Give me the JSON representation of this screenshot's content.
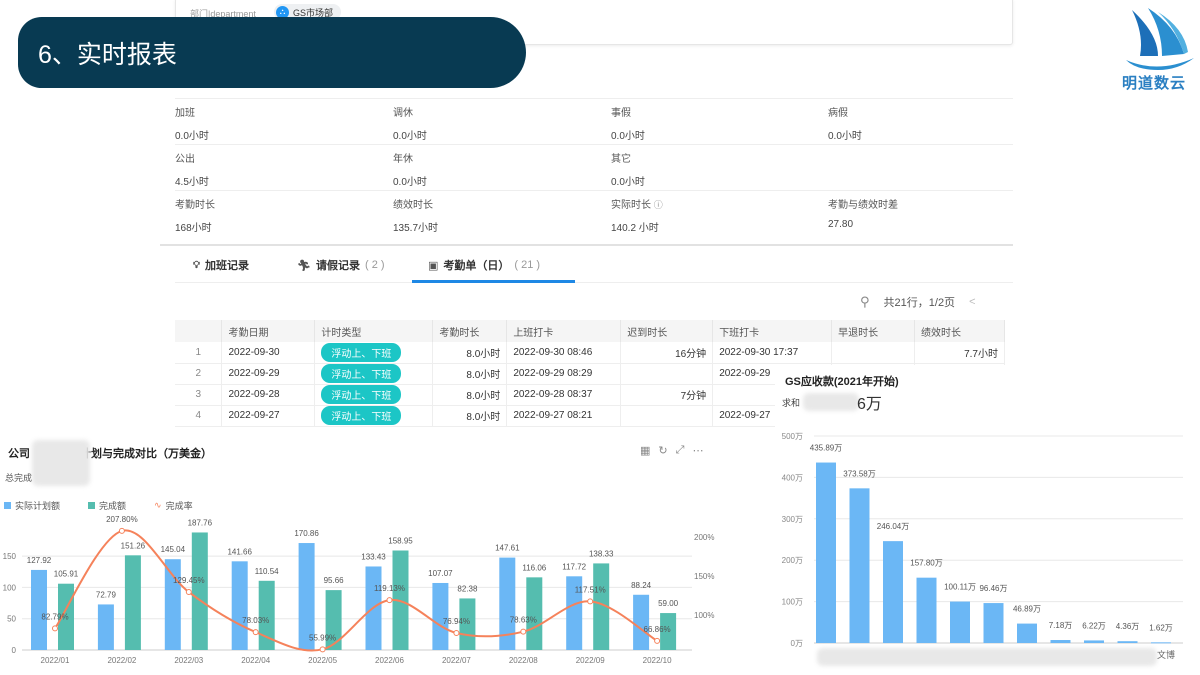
{
  "slide_title": "6、实时报表",
  "logo_text": "明道数云",
  "department": {
    "label": "部门|department",
    "value": "GS市场部"
  },
  "stats": [
    [
      {
        "label": "加班",
        "value": "0.0小时"
      },
      {
        "label": "调休",
        "value": "0.0小时"
      },
      {
        "label": "事假",
        "value": "0.0小时"
      },
      {
        "label": "病假",
        "value": "0.0小时"
      }
    ],
    [
      {
        "label": "公出",
        "value": "4.5小时"
      },
      {
        "label": "年休",
        "value": "0.0小时"
      },
      {
        "label": "其它",
        "value": "0.0小时"
      }
    ],
    [
      {
        "label": "考勤时长",
        "value": "168小时"
      },
      {
        "label": "绩效时长",
        "value": "135.7小时"
      },
      {
        "label": "实际时长",
        "value": "140.2 小时"
      },
      {
        "label": "考勤与绩效时差",
        "value": "27.80"
      }
    ]
  ],
  "tabs": [
    {
      "label": "加班记录",
      "count": ""
    },
    {
      "label": "请假记录",
      "count": "( 2 )"
    },
    {
      "label": "考勤单（日）",
      "count": "( 21 )"
    }
  ],
  "pagination": {
    "text": "共21行，1/2页",
    "prev": "<"
  },
  "table": {
    "headers": [
      "",
      "考勤日期",
      "计时类型",
      "考勤时长",
      "上班打卡",
      "迟到时长",
      "下班打卡",
      "早退时长",
      "绩效时长"
    ],
    "rows": [
      [
        "1",
        "2022-09-30",
        "浮动上、下班",
        "8.0小时",
        "2022-09-30 08:46",
        "16分钟",
        "2022-09-30 17:37",
        "",
        "7.7小时"
      ],
      [
        "2",
        "2022-09-29",
        "浮动上、下班",
        "8.0小时",
        "2022-09-29 08:29",
        "",
        "2022-09-29",
        "",
        ""
      ],
      [
        "3",
        "2022-09-28",
        "浮动上、下班",
        "8.0小时",
        "2022-09-28 08:37",
        "7分钟",
        "",
        "",
        ""
      ],
      [
        "4",
        "2022-09-27",
        "浮动上、下班",
        "8.0小时",
        "2022-09-27 08:21",
        "",
        "2022-09-27",
        "",
        ""
      ]
    ]
  },
  "left_panel": {
    "title_prefix": "公司",
    "title_suffix": "计划与完成对比（万美金）",
    "subtitle_prefix": "总完成"
  },
  "right_panel": {
    "title": "GS应收款(2021年开始)",
    "sum_prefix": "求和",
    "sum_suffix": "6万",
    "last_x_label": "文博"
  },
  "colors": {
    "plan": "#6bb7f5",
    "done": "#55bdaf",
    "rate": "#f5825b",
    "title_bg": "#083a52",
    "tag": "#1cc6c6"
  },
  "chart_data": [
    {
      "type": "bar+line",
      "title": "公司…计划与完成对比（万美金）",
      "categories": [
        "2022/01",
        "2022/02",
        "2022/03",
        "2022/04",
        "2022/05",
        "2022/06",
        "2022/07",
        "2022/08",
        "2022/09",
        "2022/10"
      ],
      "series": [
        {
          "name": "实际计划额",
          "type": "bar",
          "values": [
            127.92,
            72.79,
            145.04,
            141.66,
            170.86,
            133.43,
            107.07,
            147.61,
            117.72,
            88.24
          ]
        },
        {
          "name": "完成额",
          "type": "bar",
          "values": [
            105.91,
            151.26,
            187.76,
            110.54,
            95.66,
            158.95,
            82.38,
            116.06,
            138.33,
            59.0
          ]
        },
        {
          "name": "完成率",
          "type": "line",
          "axis": "right",
          "values": [
            82.79,
            207.8,
            129.45,
            78.03,
            55.99,
            119.13,
            76.94,
            78.63,
            117.51,
            66.86
          ]
        }
      ],
      "labels": {
        "bar1": [
          "127.92",
          "72.79",
          "145.04",
          "141.66",
          "170.86",
          "133.43",
          "107.07",
          "147.61",
          "117.72",
          "88.24"
        ],
        "bar2": [
          "105.91",
          "151.26",
          "187.76",
          "110.54",
          "95.66",
          "158.95",
          "82.38",
          "116.06",
          "138.33",
          "59.00"
        ],
        "line": [
          "82.79%",
          "207.80%",
          "129.45%",
          "78.03%",
          "55.99%",
          "119.13%",
          "76.94%",
          "78.63%",
          "117.51%",
          "66.86%"
        ]
      },
      "yticks": [
        "0",
        "50",
        "100",
        "150"
      ],
      "ytick_values": [
        0,
        50,
        100,
        150
      ],
      "y2ticks": [
        "100%",
        "150%",
        "200%"
      ],
      "y2tick_values": [
        100,
        150,
        200
      ],
      "legend": "top-left"
    },
    {
      "type": "bar",
      "title": "GS应收款(2021年开始)",
      "values": [
        435.89,
        373.58,
        246.04,
        157.8,
        100.11,
        96.46,
        46.89,
        7.18,
        6.22,
        4.36,
        1.62
      ],
      "labels": [
        "435.89万",
        "373.58万",
        "246.04万",
        "157.80万",
        "100.11万",
        "96.46万",
        "46.89万",
        "7.18万",
        "6.22万",
        "4.36万",
        "1.62万"
      ],
      "yticks": [
        "0万",
        "100万",
        "200万",
        "300万",
        "400万",
        "500万"
      ],
      "ytick_values": [
        0,
        100,
        200,
        300,
        400,
        500
      ],
      "ylim": [
        0,
        500
      ]
    }
  ]
}
